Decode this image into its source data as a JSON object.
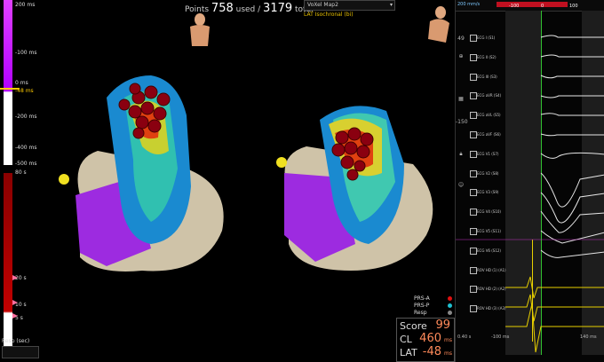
{
  "header": {
    "points_label": "Points",
    "points_used": "758",
    "used_label": "used /",
    "points_total": "3179",
    "total_label": "total",
    "map_name": "VoXel Map2",
    "map_subtitle": "LAT Isochronal (bi)"
  },
  "lat_scale": {
    "top_labels": [
      "200 ms",
      "-100 ms",
      "0 ms",
      "-48 ms",
      "-200 ms",
      "-400 ms",
      "-500 ms"
    ],
    "bottom_labels": [
      "80 s",
      "20 s",
      "10 s",
      "5 s",
      "Resp (sec)"
    ]
  },
  "legend": {
    "items": [
      {
        "label": "PRS-A",
        "color": "#e01010"
      },
      {
        "label": "PRS-P",
        "color": "#20c0d0"
      },
      {
        "label": "Resp",
        "color": "#888888"
      }
    ]
  },
  "score_box": {
    "score_label": "Score",
    "score_value": "99",
    "cl_label": "CL",
    "cl_value": "460",
    "cl_unit": "ms",
    "lat_label": "LAT",
    "lat_value": "-48",
    "lat_unit": "ms"
  },
  "ecg": {
    "speed": "200 mm/s",
    "axis_ticks": [
      "-100",
      "0",
      "100"
    ],
    "leads": [
      "ECG I (S1)",
      "ECG II (S2)",
      "ECG III (S3)",
      "ECG aVR (S4)",
      "ECG aVL (S5)",
      "ECG aVF (S6)",
      "ECG V1 (S7)",
      "ECG V2 (S8)",
      "ECG V3 (S9)",
      "ECG V4 (S10)",
      "ECG V5 (S11)",
      "ECG V6 (S12)",
      "ROV HD (1) (A1)",
      "ROV HD (2) (A2)",
      "ROV HD (3) (A3)"
    ],
    "bottom_left": "0.40 s",
    "bottom_mid": "-100 ms",
    "bottom_right": "140 ms",
    "side_values": [
      "49",
      "-150"
    ]
  },
  "colors": {
    "accent_yellow": "#e8d000",
    "score_orange": "#ff8a5a"
  }
}
